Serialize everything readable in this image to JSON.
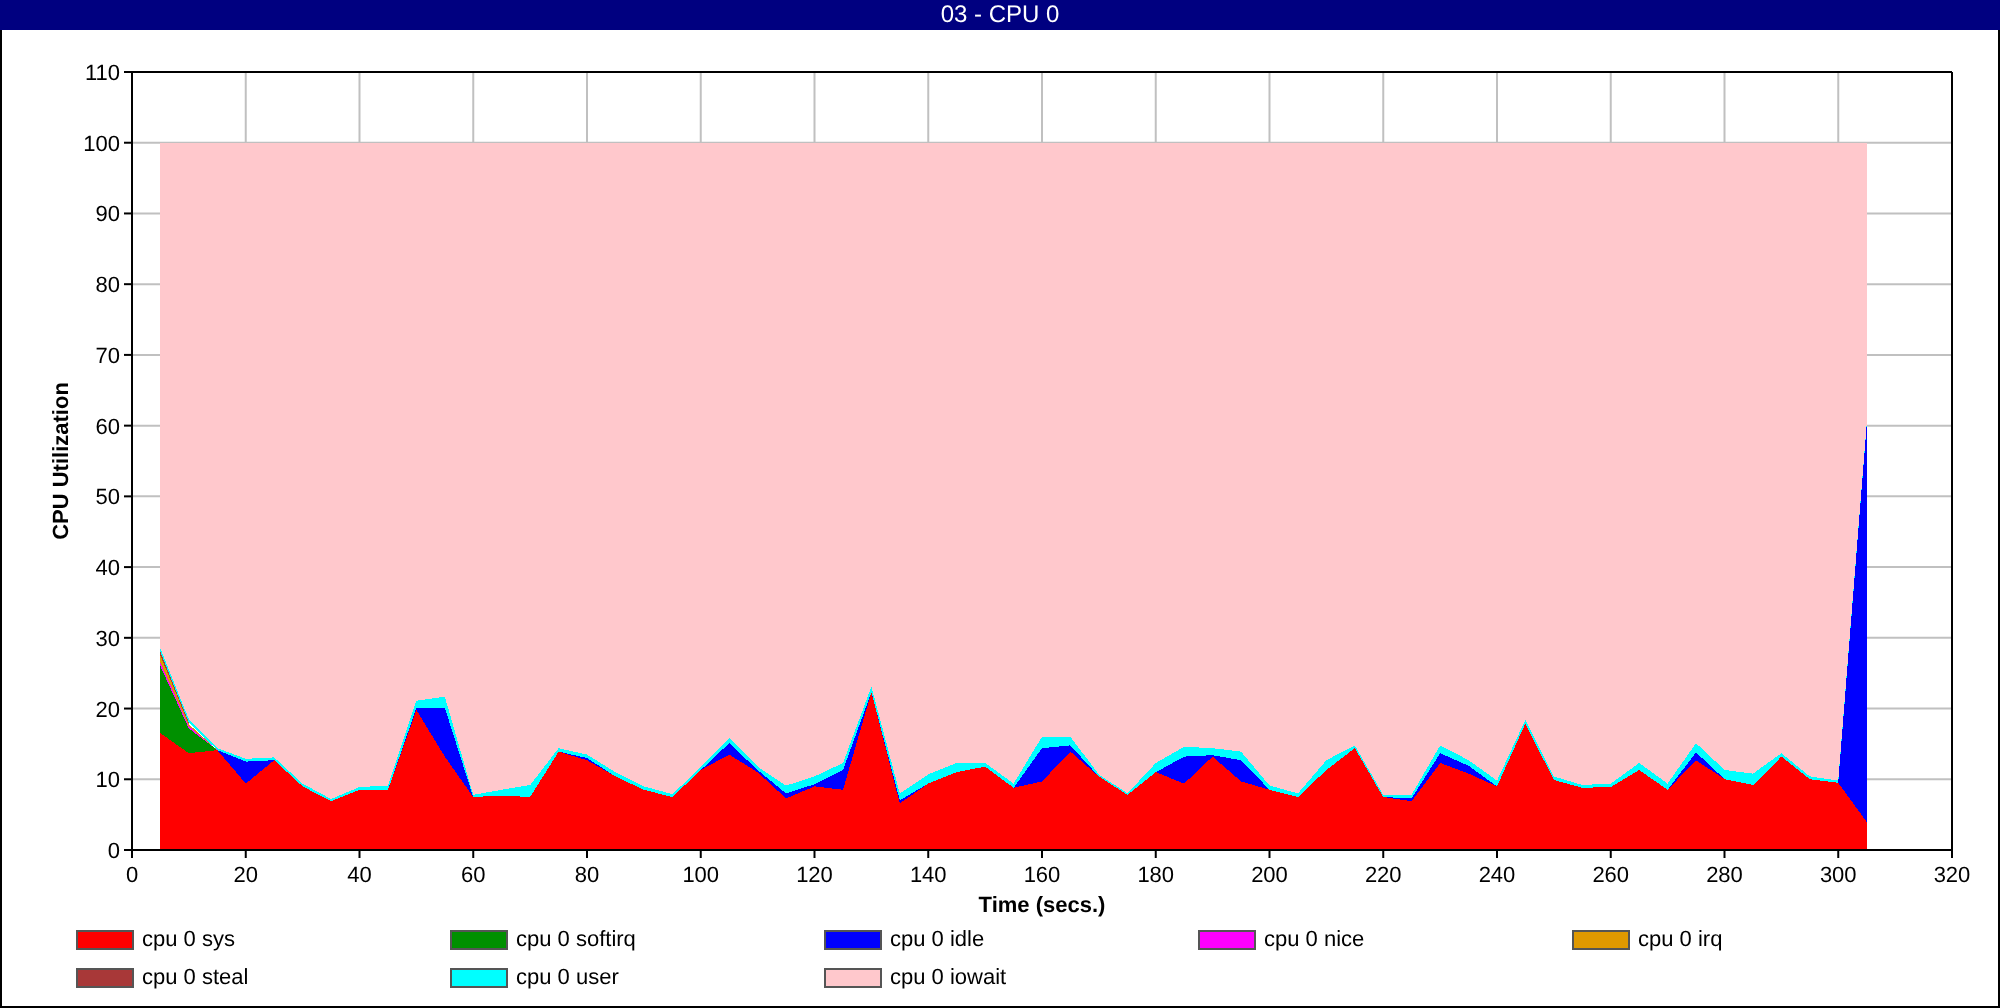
{
  "window": {
    "title": "03 - CPU 0"
  },
  "chart": {
    "chart_data": {
      "type": "area",
      "stacked": true,
      "grid": true,
      "xlabel": "Time (secs.)",
      "ylabel": "CPU Utilization",
      "xlim": [
        0,
        320
      ],
      "ylim": [
        0,
        110
      ],
      "xticks": [
        0,
        20,
        40,
        60,
        80,
        100,
        120,
        140,
        160,
        180,
        200,
        220,
        240,
        260,
        280,
        300,
        320
      ],
      "yticks": [
        0,
        10,
        20,
        30,
        40,
        50,
        60,
        70,
        80,
        90,
        100,
        110
      ],
      "x": [
        5,
        10,
        15,
        20,
        25,
        30,
        35,
        40,
        45,
        50,
        55,
        60,
        65,
        70,
        75,
        80,
        85,
        90,
        95,
        100,
        105,
        110,
        115,
        120,
        125,
        130,
        135,
        140,
        145,
        150,
        155,
        160,
        165,
        170,
        175,
        180,
        185,
        190,
        195,
        200,
        205,
        210,
        215,
        220,
        225,
        230,
        235,
        240,
        245,
        250,
        255,
        260,
        265,
        270,
        275,
        280,
        285,
        290,
        295,
        300,
        305
      ],
      "series": [
        {
          "name": "cpu 0 sys",
          "color": "#ff0000",
          "values": [
            16.5,
            13.7,
            14.1,
            9.4,
            12.7,
            9.0,
            6.9,
            8.5,
            8.5,
            19.8,
            13.2,
            7.5,
            7.7,
            7.5,
            13.9,
            12.7,
            10.4,
            8.5,
            7.5,
            11.3,
            13.5,
            11.0,
            7.3,
            9.0,
            8.5,
            22.3,
            6.6,
            9.4,
            11.0,
            11.8,
            8.8,
            9.7,
            13.9,
            10.4,
            7.8,
            11.0,
            9.4,
            13.2,
            9.7,
            8.5,
            7.5,
            11.3,
            14.4,
            7.5,
            6.9,
            12.3,
            10.8,
            9.0,
            17.9,
            9.9,
            8.8,
            8.9,
            11.3,
            8.5,
            12.7,
            10.0,
            9.2,
            13.2,
            10.0,
            9.5,
            4.0
          ]
        },
        {
          "name": "cpu 0 softirq",
          "color": "#009000",
          "values": [
            9.5,
            3.5,
            0,
            0,
            0,
            0,
            0,
            0,
            0,
            0,
            0,
            0,
            0,
            0,
            0,
            0,
            0,
            0,
            0,
            0,
            0,
            0,
            0,
            0,
            0,
            0,
            0,
            0,
            0,
            0,
            0,
            0,
            0,
            0,
            0,
            0,
            0,
            0,
            0,
            0,
            0,
            0,
            0,
            0,
            0,
            0,
            0,
            0,
            0,
            0,
            0,
            0,
            0,
            0,
            0,
            0,
            0,
            0,
            0,
            0,
            0
          ]
        },
        {
          "name": "cpu 0 idle",
          "color": "#0000ff",
          "values": [
            0,
            0,
            0,
            3.1,
            0,
            0,
            0,
            0,
            0,
            0.3,
            6.9,
            0,
            0,
            0,
            0,
            0.3,
            0,
            0,
            0,
            0,
            1.6,
            0.3,
            0.7,
            0.3,
            2.8,
            0,
            0.4,
            0,
            0,
            0,
            0,
            4.7,
            0.9,
            0,
            0,
            0,
            3.8,
            0.2,
            3.0,
            0,
            0,
            0,
            0,
            0,
            0.4,
            1.4,
            1.1,
            0,
            0,
            0,
            0,
            0,
            0,
            0,
            1.1,
            0,
            0,
            0,
            0,
            0,
            55.9
          ]
        },
        {
          "name": "cpu 0 nice",
          "color": "#ff00ff",
          "values": [
            0.5,
            0.3,
            0,
            null,
            null,
            null,
            null,
            null,
            null,
            null,
            null,
            null,
            null,
            null,
            null,
            null,
            null,
            null,
            null,
            null,
            null,
            null,
            null,
            null,
            null,
            null,
            null,
            null,
            null,
            null,
            null,
            null,
            null,
            null,
            null,
            null,
            null,
            null,
            null,
            null,
            null,
            null,
            null,
            null,
            null,
            null,
            null,
            null,
            null,
            null,
            null,
            null,
            null,
            null,
            null,
            null,
            null,
            null,
            null,
            null,
            null
          ]
        },
        {
          "name": "cpu 0 irq",
          "color": "#e09900",
          "values": [
            1.0,
            0.3,
            0,
            null,
            null,
            null,
            null,
            null,
            null,
            null,
            null,
            null,
            null,
            null,
            null,
            null,
            null,
            null,
            null,
            null,
            null,
            null,
            null,
            null,
            null,
            null,
            null,
            null,
            null,
            null,
            null,
            null,
            null,
            null,
            null,
            null,
            null,
            null,
            null,
            null,
            null,
            null,
            null,
            null,
            null,
            null,
            null,
            null,
            null,
            null,
            null,
            null,
            null,
            null,
            null,
            null,
            null,
            null,
            null,
            null,
            null
          ]
        },
        {
          "name": "cpu 0 steal",
          "color": "#a83838",
          "values": [
            0.5,
            0.2,
            null,
            null,
            null,
            null,
            null,
            null,
            null,
            null,
            null,
            null,
            null,
            null,
            null,
            null,
            null,
            null,
            null,
            null,
            null,
            null,
            null,
            null,
            null,
            null,
            null,
            null,
            null,
            null,
            null,
            null,
            null,
            null,
            null,
            null,
            null,
            null,
            null,
            null,
            null,
            null,
            null,
            null,
            null,
            null,
            null,
            null,
            null,
            null,
            null,
            null,
            null,
            null,
            null,
            null,
            null,
            null,
            null,
            null,
            null
          ]
        },
        {
          "name": "cpu 0 user",
          "color": "#00ffff",
          "values": [
            0.5,
            0.5,
            0.3,
            0.4,
            0.4,
            0.4,
            0.3,
            0.4,
            0.6,
            1.0,
            1.6,
            0.3,
            0.8,
            1.7,
            0.5,
            0.5,
            0.6,
            0.5,
            0.4,
            0.4,
            0.7,
            0.5,
            1.1,
            1.1,
            1.0,
            0.8,
            1.0,
            1.3,
            1.3,
            0.5,
            0.6,
            1.6,
            1.2,
            0.3,
            0.2,
            1.3,
            1.4,
            1.0,
            1.2,
            0.6,
            0.5,
            1.4,
            0.4,
            0.3,
            0.5,
            1.1,
            0.8,
            0.8,
            0.5,
            0.5,
            0.4,
            0.5,
            1.0,
            0.9,
            1.3,
            1.3,
            1.6,
            0.5,
            0.4,
            0.3,
            0.2
          ]
        },
        {
          "name": "cpu 0 iowait",
          "color": "#ffc8cc",
          "values": [
            71.5,
            81.5,
            85.6,
            87.1,
            86.9,
            90.6,
            92.8,
            91.1,
            90.9,
            78.9,
            78.3,
            92.2,
            91.5,
            90.8,
            85.6,
            86.5,
            89.0,
            91.0,
            92.1,
            88.3,
            84.2,
            88.2,
            90.9,
            89.6,
            87.7,
            76.9,
            92.0,
            89.3,
            87.7,
            87.7,
            90.6,
            84.0,
            84.0,
            89.3,
            92.0,
            87.7,
            85.4,
            85.6,
            86.1,
            90.9,
            92.0,
            87.3,
            85.2,
            92.2,
            92.2,
            85.2,
            87.3,
            90.2,
            81.6,
            89.6,
            90.8,
            90.6,
            87.7,
            90.6,
            84.9,
            88.7,
            89.2,
            86.3,
            89.6,
            90.2,
            39.9
          ]
        }
      ]
    }
  }
}
